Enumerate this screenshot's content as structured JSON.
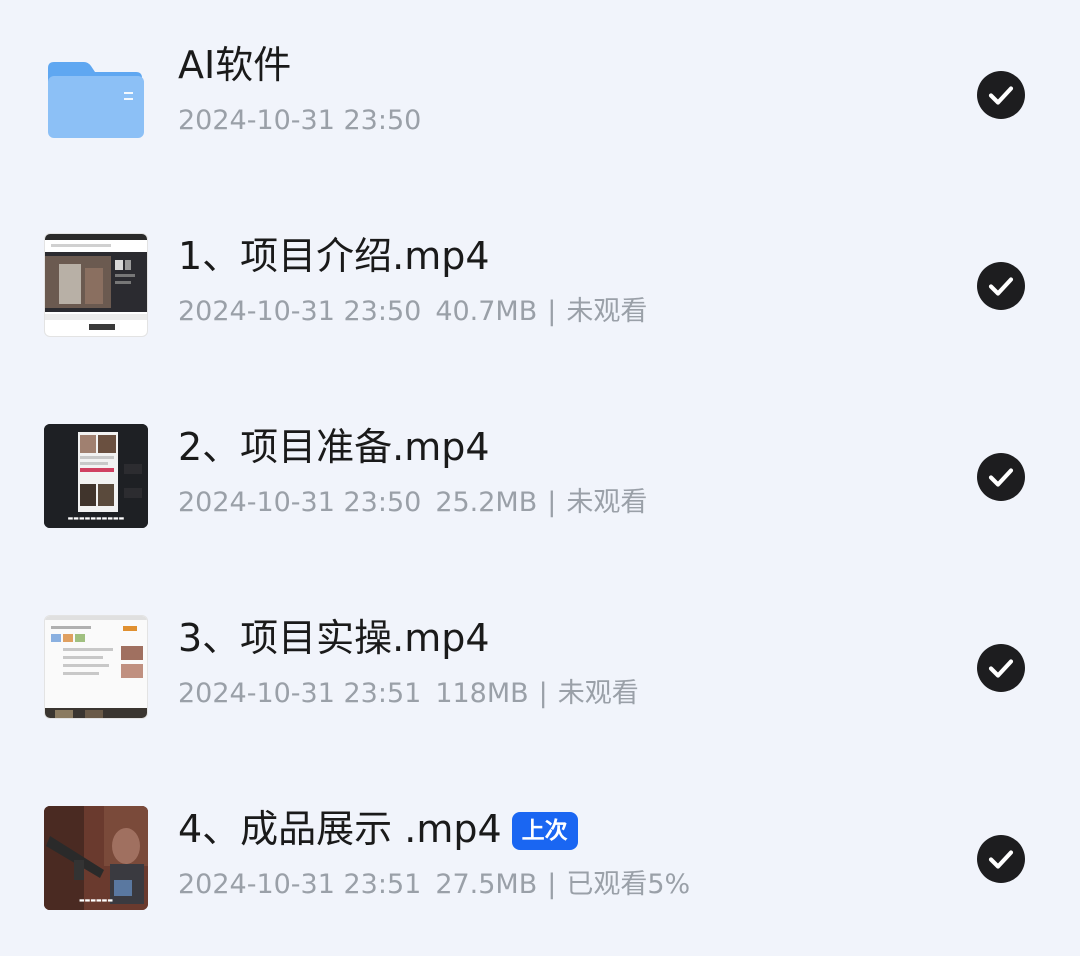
{
  "items": [
    {
      "type": "folder",
      "icon": "folder-icon",
      "title": "AI软件",
      "date": "2024-10-31 23:50",
      "selected": true
    },
    {
      "type": "video",
      "icon": "video-thumbnail",
      "title": "1、项目介绍.mp4",
      "date": "2024-10-31 23:50",
      "size": "40.7MB",
      "separator": "|",
      "status": "未观看",
      "selected": true
    },
    {
      "type": "video",
      "icon": "video-thumbnail",
      "title": "2、项目准备.mp4",
      "date": "2024-10-31 23:50",
      "size": "25.2MB",
      "separator": "|",
      "status": "未观看",
      "selected": true
    },
    {
      "type": "video",
      "icon": "video-thumbnail",
      "title": "3、项目实操.mp4",
      "date": "2024-10-31 23:51",
      "size": "118MB",
      "separator": "|",
      "status": "未观看",
      "selected": true
    },
    {
      "type": "video",
      "icon": "video-thumbnail",
      "title": "4、成品展示 .mp4",
      "badge": "上次",
      "date": "2024-10-31 23:51",
      "size": "27.5MB",
      "separator": "|",
      "status": "已观看5%",
      "selected": true
    }
  ],
  "colors": {
    "background": "#f1f4fb",
    "title": "#1a1a1a",
    "meta": "#9aa0a8",
    "badge": "#1a66f2",
    "check": "#1d1d1f"
  }
}
